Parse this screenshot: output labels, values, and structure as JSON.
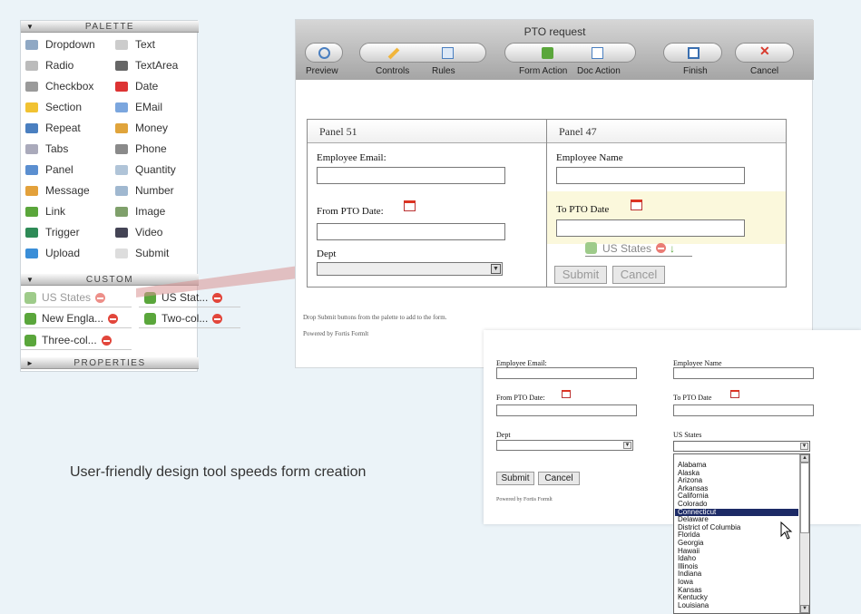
{
  "palette": {
    "header": "PALETTE",
    "items_left": [
      {
        "label": "Dropdown",
        "icon": "dropdown-icon"
      },
      {
        "label": "Radio",
        "icon": "radio-icon"
      },
      {
        "label": "Checkbox",
        "icon": "checkbox-icon"
      },
      {
        "label": "Section",
        "icon": "section-icon"
      },
      {
        "label": "Repeat",
        "icon": "repeat-icon"
      },
      {
        "label": "Tabs",
        "icon": "tabs-icon"
      },
      {
        "label": "Panel",
        "icon": "panel-icon"
      },
      {
        "label": "Message",
        "icon": "message-icon"
      },
      {
        "label": "Link",
        "icon": "link-icon"
      },
      {
        "label": "Trigger",
        "icon": "trigger-icon"
      },
      {
        "label": "Upload",
        "icon": "upload-icon"
      }
    ],
    "items_right": [
      {
        "label": "Text",
        "icon": "text-icon"
      },
      {
        "label": "TextArea",
        "icon": "textarea-icon"
      },
      {
        "label": "Date",
        "icon": "date-icon"
      },
      {
        "label": "EMail",
        "icon": "email-icon"
      },
      {
        "label": "Money",
        "icon": "money-icon"
      },
      {
        "label": "Phone",
        "icon": "phone-icon"
      },
      {
        "label": "Quantity",
        "icon": "quantity-icon"
      },
      {
        "label": "Number",
        "icon": "number-icon"
      },
      {
        "label": "Image",
        "icon": "image-icon"
      },
      {
        "label": "Video",
        "icon": "video-icon"
      },
      {
        "label": "Submit",
        "icon": "submit-icon"
      }
    ],
    "custom_header": "CUSTOM",
    "custom_items": [
      "US States",
      "US Stat...",
      "New Engla...",
      "Two-col...",
      "Three-col..."
    ],
    "properties_header": "PROPERTIES"
  },
  "designer": {
    "title": "PTO request",
    "toolbar": {
      "preview": "Preview",
      "controls": "Controls",
      "rules": "Rules",
      "form_action": "Form Action",
      "doc_action": "Doc Action",
      "finish": "Finish",
      "cancel": "Cancel"
    },
    "panel_left": {
      "title": "Panel 51",
      "employee_email": "Employee Email:",
      "from_pto_date": "From PTO Date:",
      "dept": "Dept"
    },
    "panel_right": {
      "title": "Panel 47",
      "employee_name": "Employee Name",
      "to_pto_date": "To PTO Date",
      "dragged_item": "US States",
      "submit": "Submit",
      "cancel": "Cancel"
    },
    "hint": "Drop Submit buttons from the palette to add to the form.",
    "powered_by": "Powered by Fortis Formlt"
  },
  "caption": "User-friendly design tool speeds form creation",
  "preview_form": {
    "employee_email": "Employee Email:",
    "employee_name": "Employee Name",
    "from_pto_date": "From PTO Date:",
    "to_pto_date": "To PTO Date",
    "dept": "Dept",
    "us_states": "US States",
    "submit": "Submit",
    "cancel": "Cancel",
    "powered_by": "Powered by Fortis Formlt",
    "states": [
      "Alabama",
      "Alaska",
      "Arizona",
      "Arkansas",
      "California",
      "Colorado",
      "Connecticut",
      "Delaware",
      "District of Columbia",
      "Florida",
      "Georgia",
      "Hawaii",
      "Idaho",
      "Illinois",
      "Indiana",
      "Iowa",
      "Kansas",
      "Kentucky",
      "Louisiana"
    ],
    "selected_state": "Connecticut"
  },
  "colors": {
    "accent_red": "#e2463b",
    "puzzle_green": "#5aa63b",
    "selection_navy": "#1c2a66",
    "highlight_yellow": "#fbf8dc"
  }
}
